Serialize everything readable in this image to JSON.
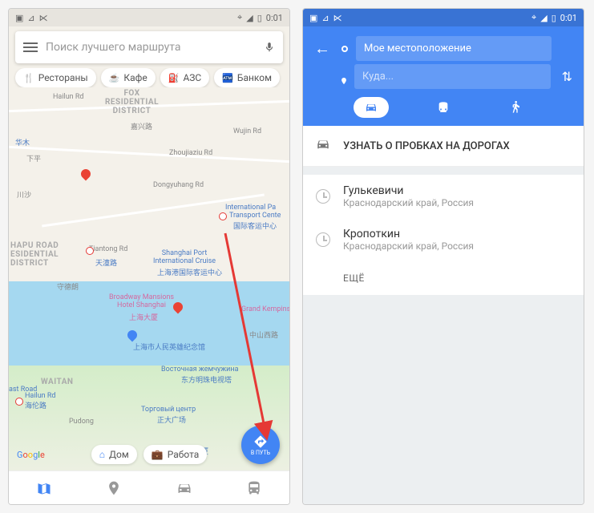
{
  "status": {
    "time": "0:01"
  },
  "left": {
    "search_placeholder": "Поиск лучшего маршрута",
    "chips": {
      "restaurants": "Рестораны",
      "cafe": "Кафе",
      "gas": "АЗС",
      "atm": "Банком"
    },
    "home": "Дом",
    "work": "Работа",
    "fab_label": "В ПУТЬ",
    "districts": {
      "fox": "FOX\nRESIDENTIAL\nDISTRICT",
      "jiaxing": "嘉兴路",
      "huamu": "华木",
      "xiaping": "下平",
      "chuansha": "川沙",
      "hailun": "Hailun Rd",
      "wujin": "Wujin Rd",
      "zhoujiaziu": "Zhoujiaziu Rd",
      "dongyuhang": "Dongyuhang Rd",
      "intl": "International Pa",
      "transport": "Transport Cente",
      "intl_cn": "国际客运中心",
      "hapu": "HAPU ROAD\nESIDENTIAL\nDISTRICT",
      "tiantong": "Tiantong Rd",
      "port": "Shanghai Port\nInternational Cruise",
      "port_cn": "上海港国际客运中心",
      "broadway": "Broadway Mansions\nHotel Shanghai",
      "broadway_cn": "上海大厦",
      "kempi": "Grand Kempins",
      "zhongshan": "中山西路",
      "museum": "上海市人民英雄纪念馆",
      "waitan": "WAITAN",
      "ast": "ast Road",
      "hailun_pk": "Hailun Rd\n海伦路",
      "tr_cn": "天潼路",
      "pearl": "Восточная жемчужина",
      "pearl_cn": "东方明珠电视塔",
      "mall": "Торговый центр",
      "mall_cn": "正大广场",
      "pudong": "Pudong",
      "bank": "花旗集团大厦"
    }
  },
  "right": {
    "origin": "Мое местоположение",
    "dest_placeholder": "Куда...",
    "traffic": "УЗНАТЬ О ПРОБКАХ НА ДОРОГАХ",
    "history": [
      {
        "title": "Гулькевичи",
        "sub": "Краснодарский край, Россия"
      },
      {
        "title": "Кропоткин",
        "sub": "Краснодарский край, Россия"
      }
    ],
    "more": "ЕЩЁ"
  }
}
